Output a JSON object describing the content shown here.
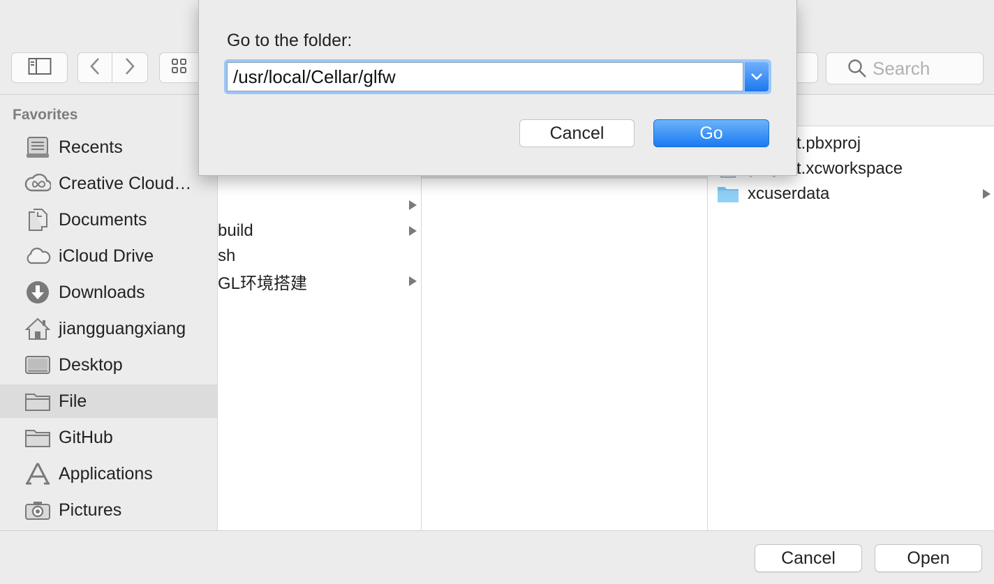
{
  "toolbar": {
    "search_placeholder": "Search"
  },
  "sidebar": {
    "header": "Favorites",
    "items": [
      {
        "label": "Recents",
        "icon": "recents-icon"
      },
      {
        "label": "Creative Cloud…",
        "icon": "creative-cloud-icon"
      },
      {
        "label": "Documents",
        "icon": "documents-icon"
      },
      {
        "label": "iCloud Drive",
        "icon": "icloud-icon"
      },
      {
        "label": "Downloads",
        "icon": "downloads-icon"
      },
      {
        "label": "jiangguangxiang",
        "icon": "home-icon"
      },
      {
        "label": "Desktop",
        "icon": "desktop-icon"
      },
      {
        "label": "File",
        "icon": "folder-icon",
        "selected": true
      },
      {
        "label": "GitHub",
        "icon": "folder-icon"
      },
      {
        "label": "Applications",
        "icon": "applications-icon"
      },
      {
        "label": "Pictures",
        "icon": "camera-icon"
      }
    ]
  },
  "column1": {
    "rows": [
      "build",
      "sh",
      "GL环境搭建"
    ]
  },
  "column3": {
    "rows": [
      "t.pbxproj",
      "t.xcworkspace",
      "xcuserdata"
    ]
  },
  "bottom_bar": {
    "cancel_label": "Cancel",
    "open_label": "Open"
  },
  "goto_sheet": {
    "title": "Go to the folder:",
    "path_value": "/usr/local/Cellar/glfw",
    "cancel_label": "Cancel",
    "go_label": "Go"
  },
  "colors": {
    "accent": "#1a7bf2",
    "focus_ring": "#9cc7f7",
    "folder": "#74c0f0"
  }
}
